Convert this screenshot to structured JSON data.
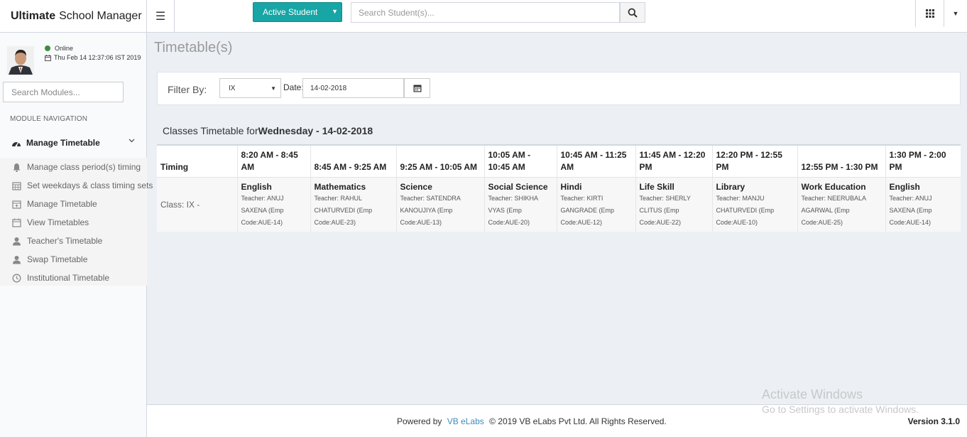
{
  "app": {
    "brand_bold": "Ultimate",
    "brand_rest": "School Manager"
  },
  "header": {
    "active_student_label": "Active Student",
    "search_placeholder": "Search Student(s)..."
  },
  "sidebar": {
    "status": "Online",
    "datetime": "Thu Feb 14 12:37:06 IST 2019",
    "search_placeholder": "Search Modules...",
    "nav_heading": "MODULE NAVIGATION",
    "group_label": "Manage Timetable",
    "items": [
      {
        "label": "Manage class period(s) timing",
        "icon": "bell-icon"
      },
      {
        "label": "Set weekdays & class timing sets",
        "icon": "calendar-grid-icon"
      },
      {
        "label": "Manage Timetable",
        "icon": "calendar-plus-icon"
      },
      {
        "label": "View Timetables",
        "icon": "calendar-view-icon"
      },
      {
        "label": "Teacher's Timetable",
        "icon": "user-icon"
      },
      {
        "label": "Swap Timetable",
        "icon": "user-icon"
      },
      {
        "label": "Institutional Timetable",
        "icon": "clock-icon"
      }
    ]
  },
  "main": {
    "page_title": "Timetable(s)",
    "filter": {
      "label": "Filter By:",
      "class_value": "IX",
      "date_label": "Date:",
      "date_value": "14-02-2018"
    },
    "timetable_title_prefix": "Classes Timetable for",
    "timetable_title_bold": "Wednesday - 14-02-2018",
    "timing_header": "Timing",
    "row_label": "Class: IX -",
    "periods": [
      {
        "time": "8:20 AM - 8:45 AM",
        "subject": "English",
        "teacher": "Teacher: ANUJ SAXENA (Emp Code:AUE-14)"
      },
      {
        "time": "8:45 AM - 9:25 AM",
        "subject": "Mathematics",
        "teacher": "Teacher: RAHUL CHATURVEDI (Emp Code:AUE-23)"
      },
      {
        "time": "9:25 AM - 10:05 AM",
        "subject": "Science",
        "teacher": "Teacher: SATENDRA KANOUJIYA (Emp Code:AUE-13)"
      },
      {
        "time": "10:05 AM - 10:45 AM",
        "subject": "Social Science",
        "teacher": "Teacher: SHIKHA VYAS (Emp Code:AUE-20)"
      },
      {
        "time": "10:45 AM - 11:25 AM",
        "subject": "Hindi",
        "teacher": "Teacher: KIRTI GANGRADE (Emp Code:AUE-12)"
      },
      {
        "time": "11:45 AM - 12:20 PM",
        "subject": "Life Skill",
        "teacher": "Teacher: SHERLY CLITUS (Emp Code:AUE-22)"
      },
      {
        "time": "12:20 PM - 12:55 PM",
        "subject": "Library",
        "teacher": "Teacher: MANJU CHATURVEDI (Emp Code:AUE-10)"
      },
      {
        "time": "12:55 PM - 1:30 PM",
        "subject": "Work Education",
        "teacher": "Teacher: NEERUBALA AGARWAL (Emp Code:AUE-25)"
      },
      {
        "time": "1:30 PM - 2:00 PM",
        "subject": "English",
        "teacher": "Teacher: ANUJ SAXENA (Emp Code:AUE-14)"
      }
    ]
  },
  "footer": {
    "powered_by": "Powered by",
    "vendor_link": "VB eLabs",
    "copyright": "© 2019 VB eLabs Pvt Ltd. All Rights Reserved.",
    "version": "Version 3.1.0"
  },
  "watermark": {
    "line1": "Activate Windows",
    "line2": "Go to Settings to activate Windows."
  }
}
